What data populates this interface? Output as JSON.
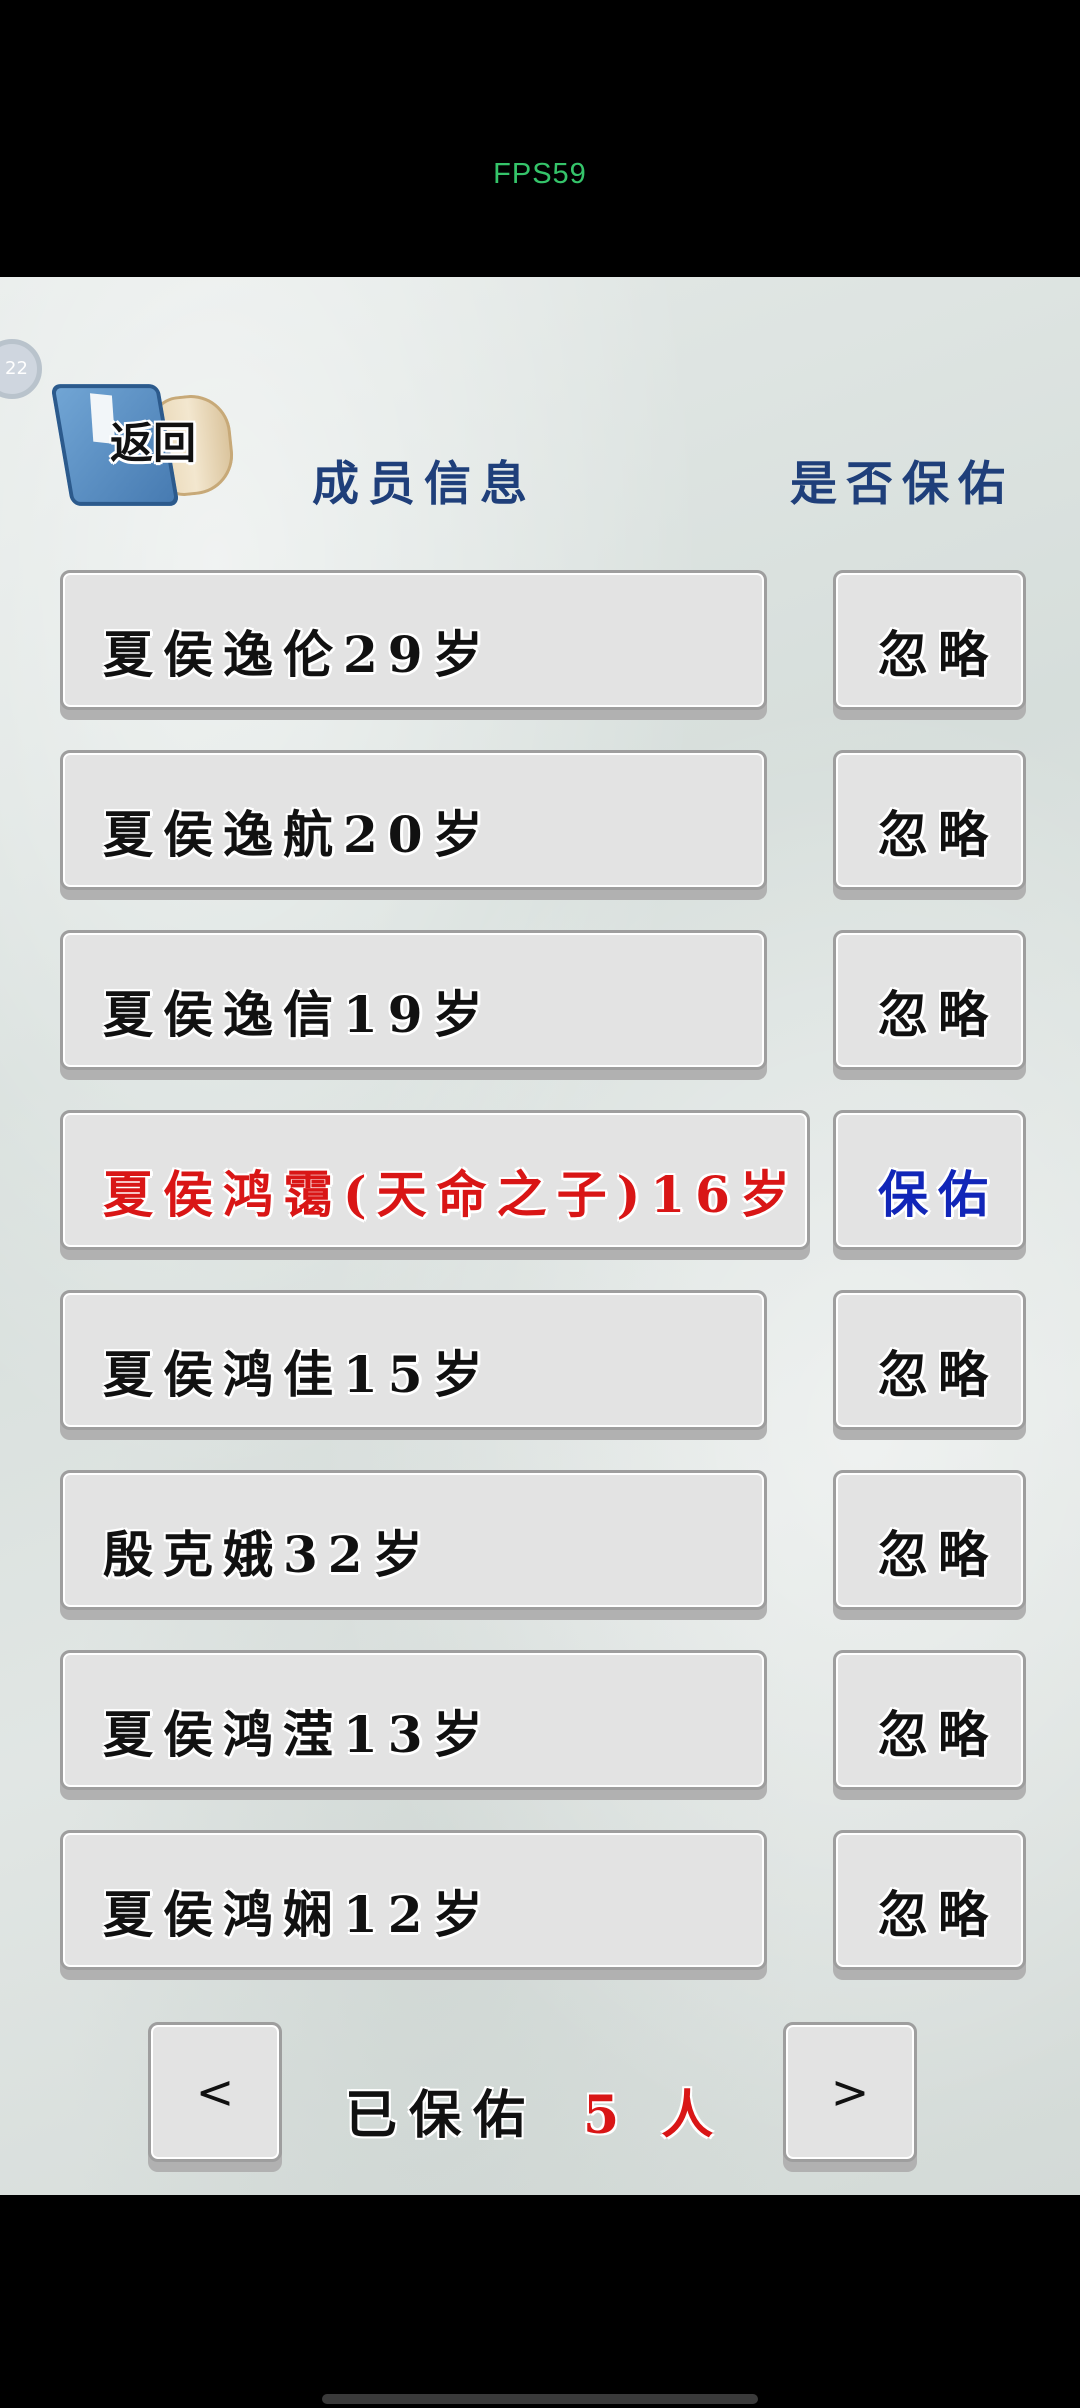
{
  "status": {
    "fps": "FPS59"
  },
  "edge_badge": "22",
  "header": {
    "back_label": "返回",
    "col_member": "成员信息",
    "col_protect": "是否保佑"
  },
  "members": [
    {
      "name": "夏侯逸伦29岁",
      "action": "忽略",
      "highlight": false
    },
    {
      "name": "夏侯逸航20岁",
      "action": "忽略",
      "highlight": false
    },
    {
      "name": "夏侯逸信19岁",
      "action": "忽略",
      "highlight": false
    },
    {
      "name": "夏侯鸿霭(天命之子)16岁",
      "action": "保佑",
      "highlight": true
    },
    {
      "name": "夏侯鸿佳15岁",
      "action": "忽略",
      "highlight": false
    },
    {
      "name": "殷克娥32岁",
      "action": "忽略",
      "highlight": false
    },
    {
      "name": "夏侯鸿滢13岁",
      "action": "忽略",
      "highlight": false
    },
    {
      "name": "夏侯鸿娴12岁",
      "action": "忽略",
      "highlight": false
    }
  ],
  "footer": {
    "prev_label": "<",
    "next_label": ">",
    "protected_label": "已保佑",
    "protected_count": "5 人"
  },
  "colors": {
    "header_text": "#1f3f7a",
    "highlight_name": "#d91616",
    "highlight_action": "#1126b8",
    "fps_text": "#35c46a"
  }
}
